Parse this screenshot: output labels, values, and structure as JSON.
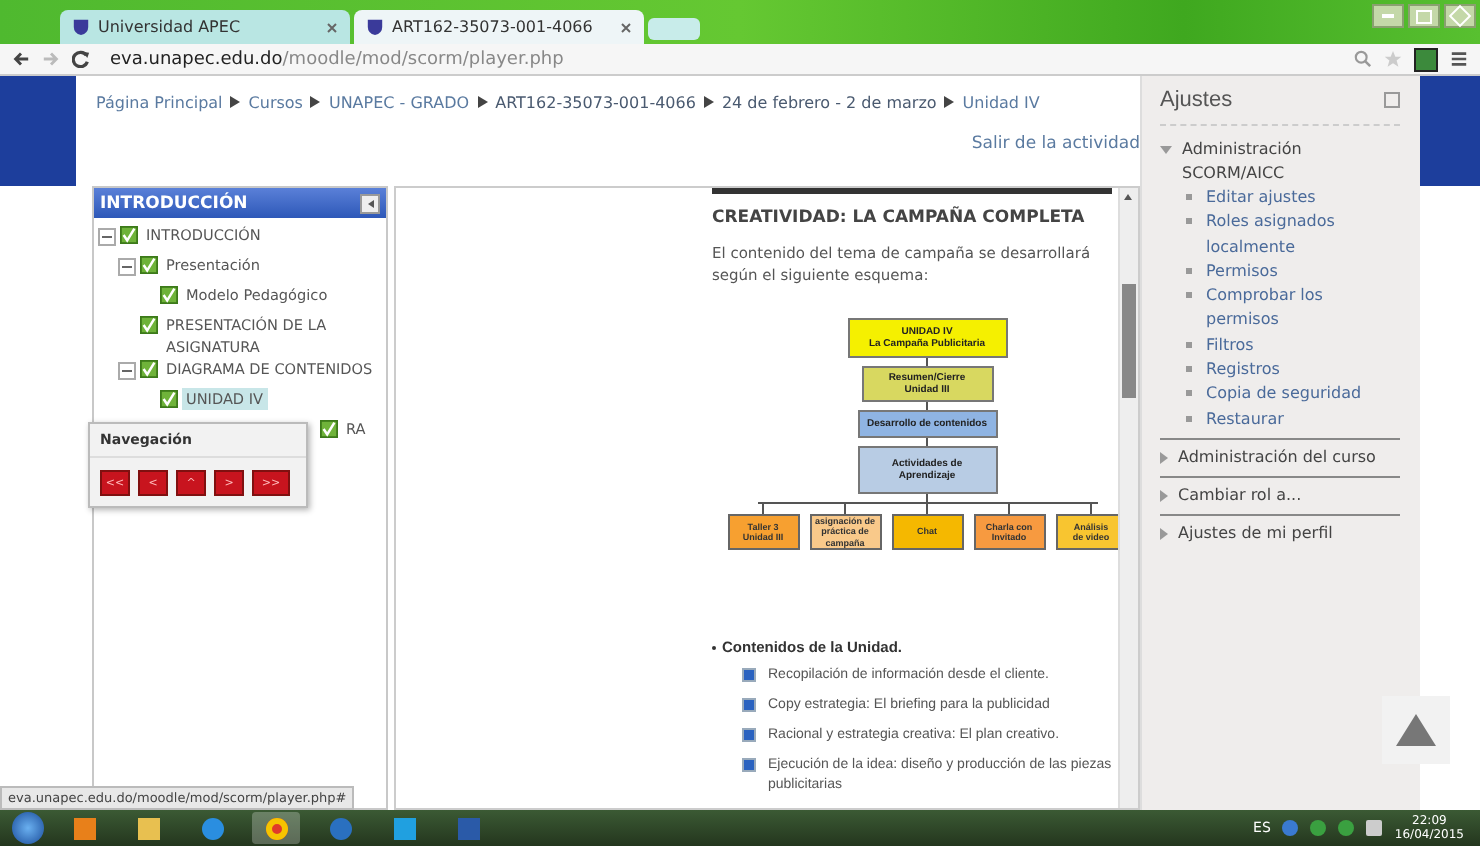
{
  "browser": {
    "tabs": [
      {
        "title": "Universidad APEC",
        "selected": false
      },
      {
        "title": "ART162-35073-001-4066",
        "selected": true
      }
    ],
    "address": {
      "domain": "eva.unapec.edu.do",
      "path": "/moodle/mod/scorm/player.php"
    }
  },
  "breadcrumb": [
    "Página Principal",
    "Cursos",
    "UNAPEC - GRADO",
    "ART162-35073-001-4066",
    "24 de febrero - 2 de marzo",
    "Unidad IV"
  ],
  "exit_link": "Salir de la actividad",
  "toc": {
    "title": "INTRODUCCIÓN",
    "tree": [
      {
        "label": "INTRODUCCIÓN",
        "expanded": true,
        "selected": false,
        "children": [
          {
            "label": "Presentación",
            "expanded": true,
            "selected": false,
            "children": [
              {
                "label": "Modelo Pedagógico",
                "selected": false
              }
            ]
          },
          {
            "label": "PRESENTACIÓN DE LA ASIGNATURA",
            "selected": false
          },
          {
            "label": "DIAGRAMA DE CONTENIDOS",
            "expanded": true,
            "selected": false,
            "children": [
              {
                "label": "UNIDAD IV",
                "selected": true
              }
            ]
          },
          {
            "label": "RA",
            "selected": false
          }
        ]
      }
    ]
  },
  "navigation": {
    "title": "Navegación",
    "buttons": [
      "<<",
      "<",
      "^",
      ">",
      ">>"
    ]
  },
  "content": {
    "heading": "CREATIVIDAD: LA CAMPAÑA COMPLETA",
    "intro": "El contenido del tema de campaña se desarrollará según el siguiente esquema:",
    "diagram": {
      "levels": [
        {
          "lines": [
            "UNIDAD IV",
            "La Campaña Publicitaria"
          ],
          "color": "#f5f000"
        },
        {
          "lines": [
            "Resumen/Cierre Unidad III"
          ],
          "color": "#d8d860"
        },
        {
          "lines": [
            "Desarrollo de contenidos"
          ],
          "color": "#8fb4e3"
        },
        {
          "lines": [
            "Actividades de Aprendizaje"
          ],
          "color": "#b8cce4"
        }
      ],
      "activities": [
        {
          "lines": [
            "Taller 3",
            "Unidad III"
          ],
          "color": "#f7a030"
        },
        {
          "lines": [
            "asignación de",
            "práctica de campaña"
          ],
          "color": "#f9c98a"
        },
        {
          "lines": [
            "Chat"
          ],
          "color": "#f5b800"
        },
        {
          "lines": [
            "Charla con",
            "Invitado"
          ],
          "color": "#f79a40"
        },
        {
          "lines": [
            "Análisis",
            "de video"
          ],
          "color": "#f8c530"
        }
      ]
    },
    "list_title": "Contenidos de la Unidad.",
    "list_items": [
      "Recopilación de información desde el cliente.",
      "Copy estrategia: El briefing para la publicidad",
      "Racional y estrategia creativa: El plan creativo.",
      "Ejecución de la idea: diseño y producción de las piezas publicitarias"
    ]
  },
  "settings": {
    "title": "Ajustes",
    "sections": [
      {
        "label": "Administración SCORM/AICC",
        "expanded": true,
        "items": [
          "Editar ajustes",
          "Roles asignados localmente",
          "Permisos",
          "Comprobar los permisos",
          "Filtros",
          "Registros",
          "Copia de seguridad",
          "Restaurar"
        ]
      },
      {
        "label": "Administración del curso",
        "expanded": false
      },
      {
        "label": "Cambiar rol a...",
        "expanded": false
      },
      {
        "label": "Ajustes de mi perfil",
        "expanded": false
      }
    ]
  },
  "status_url": "eva.unapec.edu.do/moodle/mod/scorm/player.php#",
  "taskbar": {
    "language": "ES",
    "time": "22:09",
    "date": "16/04/2015"
  }
}
